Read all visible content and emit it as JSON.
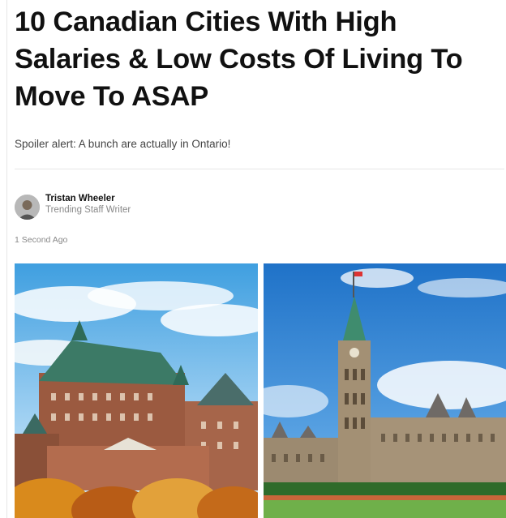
{
  "article": {
    "headline": "10 Canadian Cities With High Salaries & Low Costs Of Living To Move To ASAP",
    "dek": "Spoiler alert: A bunch are actually in Ontario!"
  },
  "author": {
    "name": "Tristan Wheeler",
    "role": "Trending Staff Writer",
    "timestamp": "1 Second Ago"
  }
}
